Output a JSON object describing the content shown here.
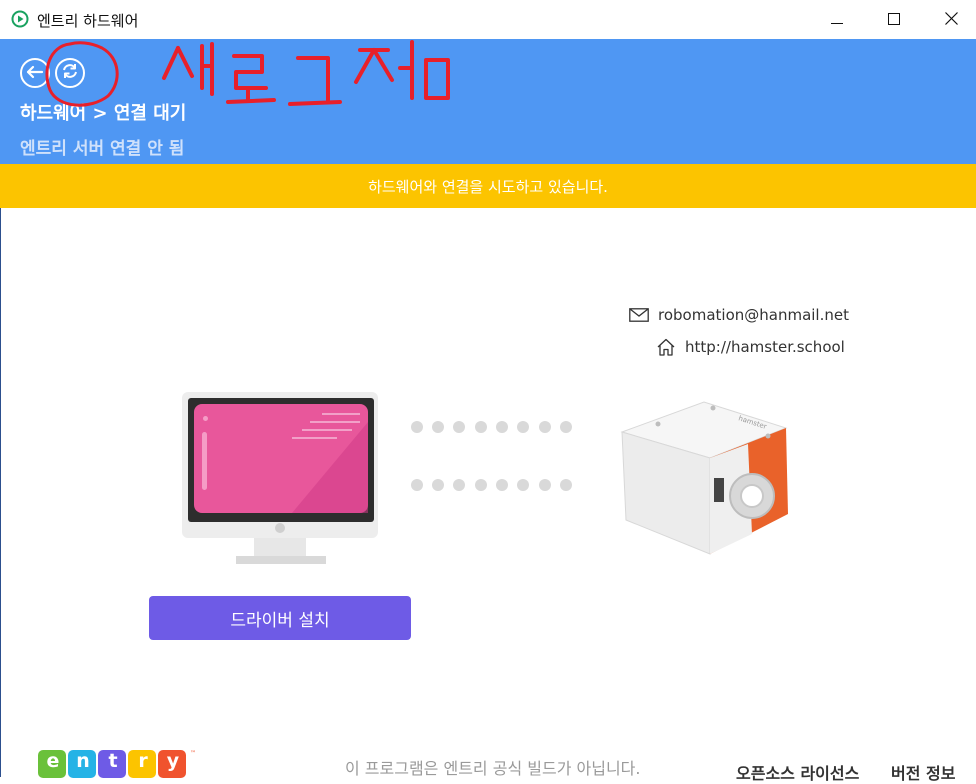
{
  "window": {
    "title": "엔트리 하드웨어",
    "app_icon": "play-circle-icon",
    "controls": [
      "minimize-icon",
      "maximize-icon",
      "close-icon"
    ]
  },
  "header": {
    "breadcrumb": "하드웨어 > 연결 대기",
    "server_status": "엔트리 서버 연결 안 됨",
    "buttons": [
      "back-arrow-icon",
      "refresh-icon"
    ],
    "annotation_text": "새로고침"
  },
  "banner": {
    "message": "하드웨어와 연결을 시도하고 있습니다."
  },
  "contacts": {
    "email": "robomation@hanmail.net",
    "homepage": "http://hamster.school"
  },
  "main": {
    "driver_button": "드라이버 설치"
  },
  "footer": {
    "logo_letters": [
      "e",
      "n",
      "t",
      "r",
      "y"
    ],
    "notice": "이 프로그램은 엔트리 공식 빌드가 아닙니다.",
    "license_link": "오픈소스 라이선스",
    "version_link": "버전 정보"
  },
  "colors": {
    "header_bg": "#4f97f3",
    "banner_bg": "#fcc400",
    "driver_button_bg": "#6e5be6",
    "annotation": "#e8202a"
  }
}
